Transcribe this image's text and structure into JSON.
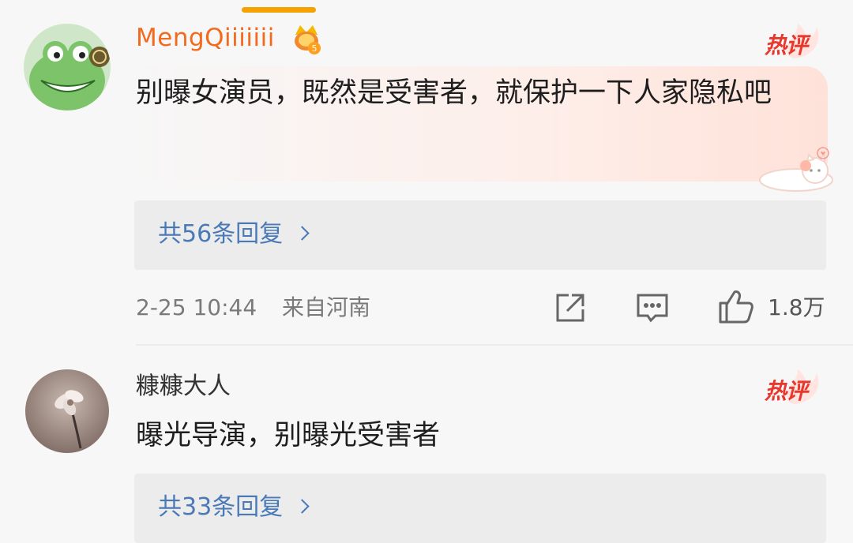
{
  "comments": [
    {
      "username": "MengQiiiiiii",
      "vip_icon": "crown-vip-level-icon",
      "vip_level": "5",
      "hot_badge": "热评",
      "content": "别曝女演员，既然是受害者，就保护一下人家隐私吧",
      "replies_label": "共56条回复",
      "timestamp": "2-25 10:44",
      "location": "来自河南",
      "like_count": "1.8万"
    },
    {
      "username": "糠糠大人",
      "hot_badge": "热评",
      "content": "曝光导演，别曝光受害者",
      "replies_label": "共33条回复"
    }
  ],
  "icons": {
    "share": "share-icon",
    "comment": "comment-icon",
    "like": "thumbs-up-icon",
    "chevron": "chevron-right-icon"
  },
  "colors": {
    "username_highlight": "#f26b1d",
    "link": "#4a79b7",
    "hot_badge": "#e8372c",
    "indicator": "#f5a200"
  }
}
